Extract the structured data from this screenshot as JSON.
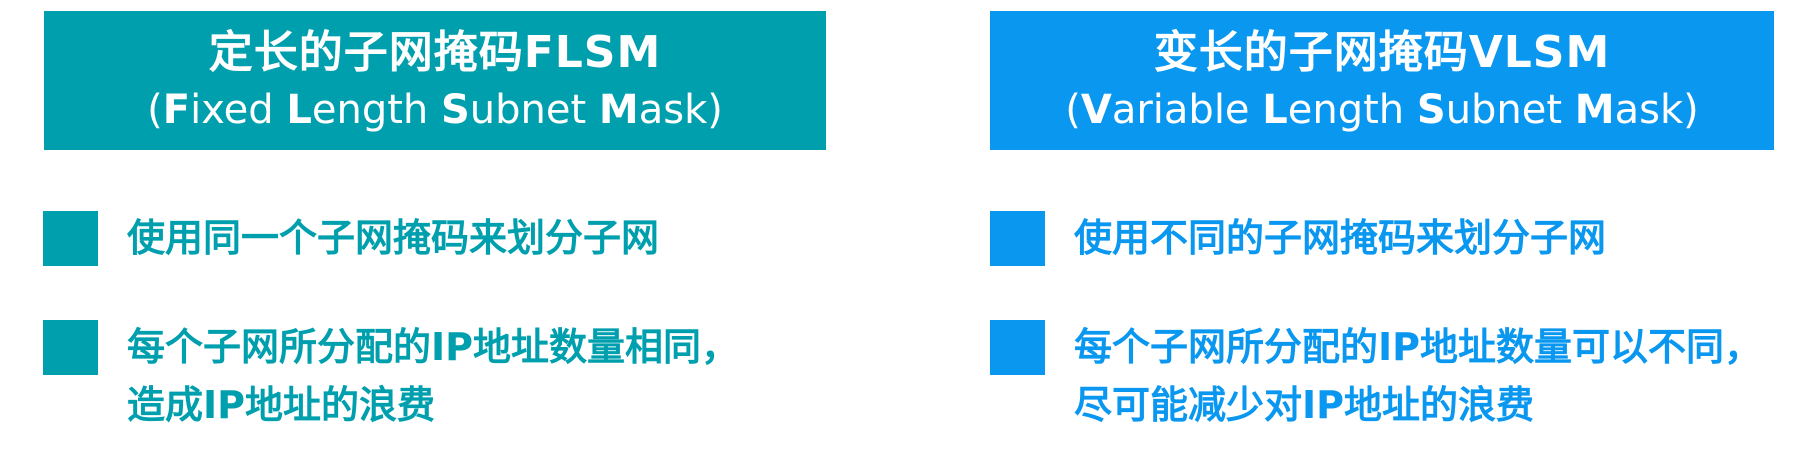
{
  "colors": {
    "flsm": "#009FAE",
    "vlsm": "#0A97F0"
  },
  "flsm": {
    "title": "定长的子网掩码FLSM",
    "subtitle": {
      "open": "(",
      "w1_first": "F",
      "w1_rest": "ixed ",
      "w2_first": "L",
      "w2_rest": "ength ",
      "w3_first": "S",
      "w3_rest": "ubnet ",
      "w4_first": "M",
      "w4_rest": "ask",
      "close": ")"
    },
    "bullets": [
      "使用同一个子网掩码来划分子网",
      "每个子网所分配的IP地址数量相同，造成IP地址的浪费"
    ]
  },
  "vlsm": {
    "title": "变长的子网掩码VLSM",
    "subtitle": {
      "open": "(",
      "w1_first": "V",
      "w1_rest": "ariable ",
      "w2_first": "L",
      "w2_rest": "ength ",
      "w3_first": "S",
      "w3_rest": "ubnet ",
      "w4_first": "M",
      "w4_rest": "ask",
      "close": ")"
    },
    "bullets": [
      "使用不同的子网掩码来划分子网",
      "每个子网所分配的IP地址数量可以不同，尽可能减少对IP地址的浪费"
    ]
  }
}
